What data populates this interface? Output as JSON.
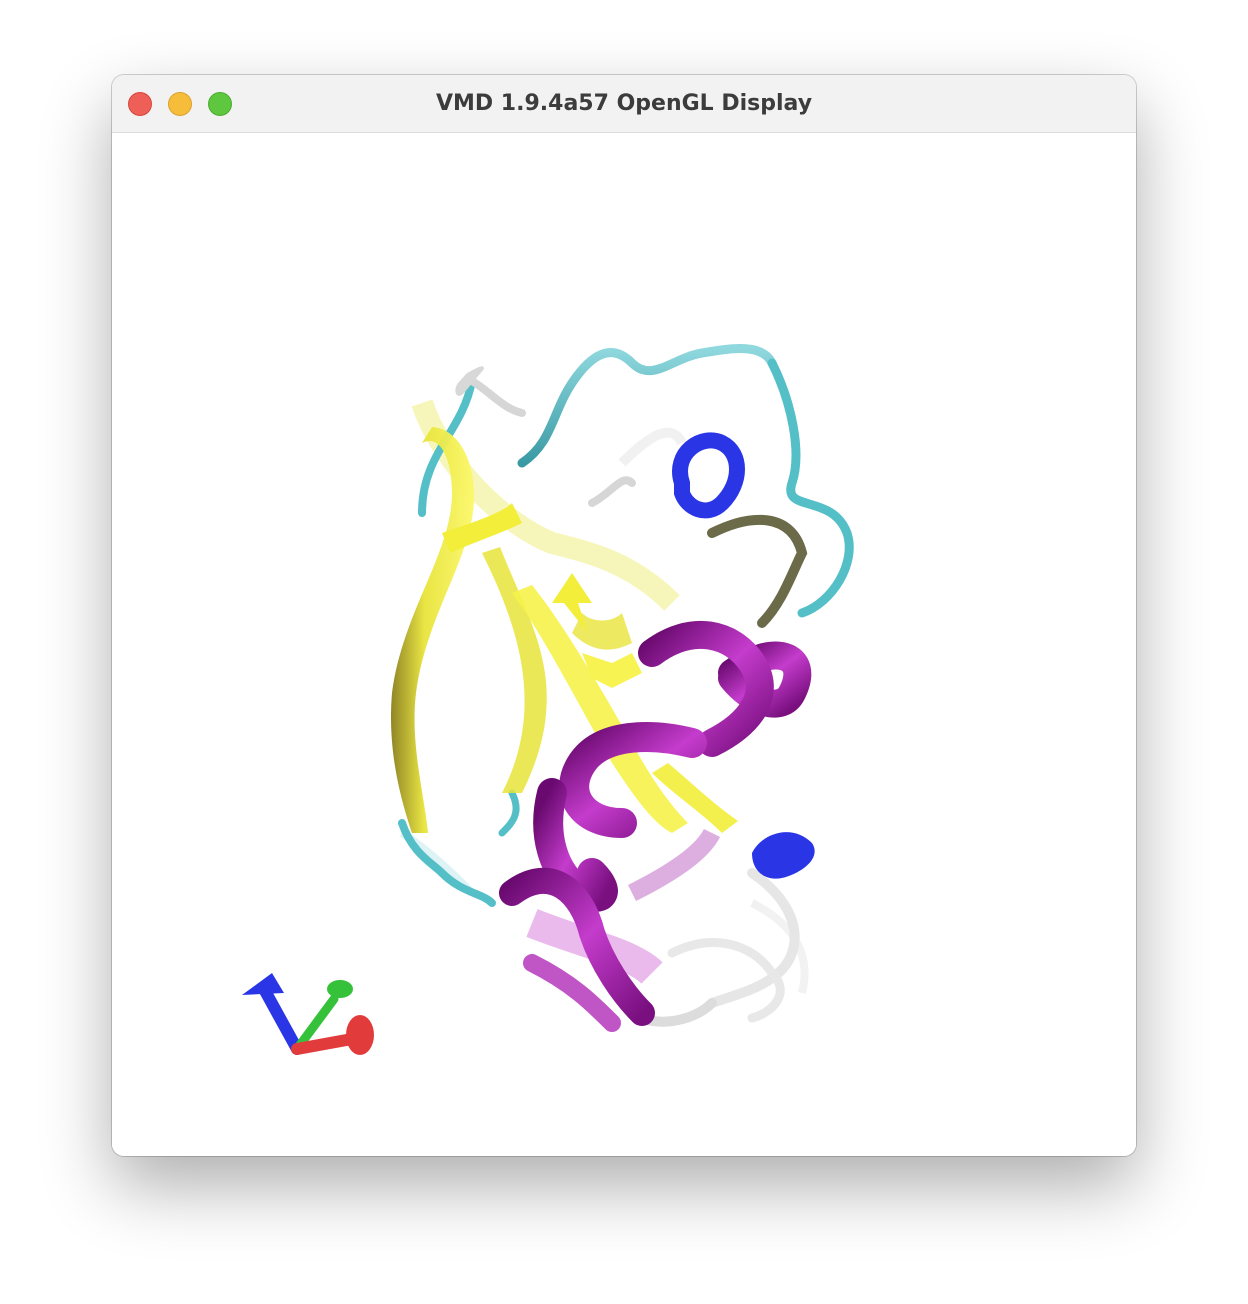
{
  "window": {
    "title": "VMD 1.9.4a57 OpenGL Display",
    "buttons": {
      "close": "close-button",
      "minimize": "minimize-button",
      "zoom": "zoom-button"
    }
  },
  "display": {
    "background": "#ffffff",
    "representation": "NewCartoon",
    "coloring": "secondary structure",
    "colors": {
      "beta_sheet": "#f2ee3a",
      "alpha_helix": "#a01aa8",
      "helix_310": "#2a36e6",
      "turn": "#55bfc8",
      "coil": "#e6e6e6"
    }
  },
  "axes": {
    "x_color": "#e23b3b",
    "y_color": "#35c23a",
    "z_color": "#2a36e6"
  }
}
